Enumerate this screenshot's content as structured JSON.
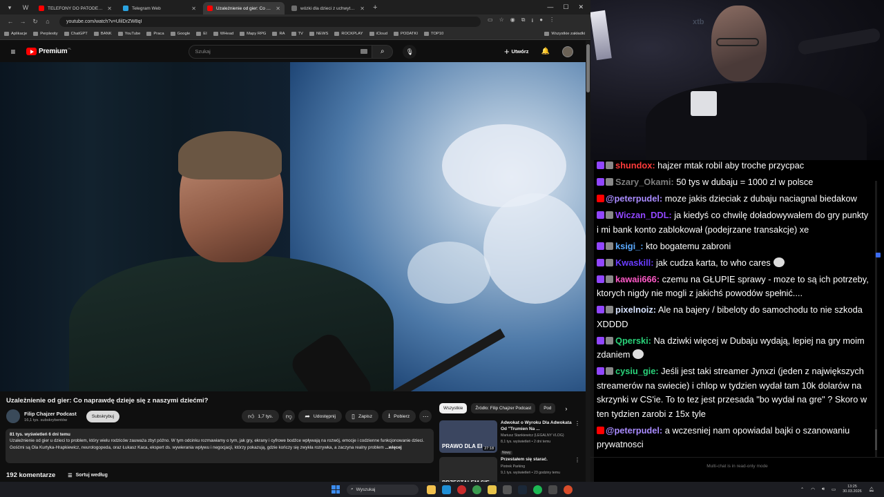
{
  "browser": {
    "tabs": [
      {
        "label": "TELEFONY DO PATODEWELOPE",
        "color": "#ff0000",
        "active": false
      },
      {
        "label": "Telegram Web",
        "color": "#2aa3e0",
        "active": false
      },
      {
        "label": "Uzależnienie od gier: Co napraw",
        "color": "#ff0000",
        "active": true
      },
      {
        "label": "wózki dla dzieci z uchwytem na",
        "color": "#6e6e6e",
        "active": false
      }
    ],
    "url": "youtube.com/watch?v=UlilDrZW8qI",
    "bookmarks": [
      "Aplikacje",
      "Perplexity",
      "ChatGPT",
      "BANK",
      "YouTube",
      "Praca",
      "Google",
      "EI",
      "WHead",
      "Mapy RPG",
      "RA",
      "TV",
      "NEWS",
      "ROCKPLAY",
      "iCloud",
      "PODATKI",
      "TOP10"
    ],
    "all_bookmarks": "Wszystkie zakładki"
  },
  "youtube": {
    "logo_text": "Premium",
    "logo_country": "PL",
    "search_placeholder": "Szukaj",
    "create_label": "Utwórz",
    "video_title": "Uzależnienie od gier: Co naprawdę dzieje się z naszymi dziećmi?",
    "channel_name": "Filip Chajzer Podcast",
    "channel_subs": "16,1 tys. subskrybentów",
    "subscribe_label": "Subskrybuj",
    "likes": "1,7 tys.",
    "share_label": "Udostępnij",
    "save_label": "Zapisz",
    "download_label": "Pobierz",
    "desc_meta": "81 tys. wyświetleń  6 dni temu",
    "desc_text": "Uzależnienie od gier u dzieci to problem, który wielu rodziców zauważa zbyt późno. W tym odcinku rozmawiamy o tym, jak gry, ekrany i cyfrowe bodźce wpływają na rozwój, emocje i codzienne funkcjonowanie dzieci. Gośćmi są Ola Kurtyka-Hrapkiewicz, neurologopeda, oraz Łukasz Kaca, ekspert ds. wywierania wpływu i negocjacji, którzy pokazują, gdzie kończy się zwykła rozrywka, a zaczyna realny problem",
    "desc_more": "...więcej",
    "comments_count": "192 komentarze",
    "sort_label": "Sortuj według",
    "chips": [
      "Wszystkie",
      "Źródło: Filip Chajzer Podcast",
      "Pod"
    ],
    "recs": [
      {
        "title": "Adwokat o Wyroku Dla Adwokata Od \"Trumien Na ...",
        "channel": "Mariusz Stankiewicz (LEGALNY VLOG)",
        "meta": "8,1 tys. wyświetleń • 2 dni temu",
        "badge": "Nowy",
        "duration": "27:18",
        "overlay": "PRAWO DLA EI",
        "thumb": "#3b4660"
      },
      {
        "title": "Przestałem się starać.",
        "channel": "Piotrek Parking",
        "meta": "9,1 tys. wyświetleń • 23 godziny temu",
        "badge": "",
        "duration": "",
        "overlay": "PRZESTAŁEM SIĘ",
        "thumb": "#2a2a2a"
      }
    ]
  },
  "chat": {
    "messages": [
      {
        "platform": "twitch",
        "user": "shundox:",
        "color": "#ff3b3b",
        "text": "hajzer mtak robil aby troche przycpac",
        "emote": false
      },
      {
        "platform": "twitch",
        "user": "Szary_Okami:",
        "color": "#7d7d7d",
        "text": "50 tys w dubaju = 1000 zl w polsce",
        "emote": false
      },
      {
        "platform": "yt",
        "user": "@peterpudel:",
        "color": "#a98bff",
        "text": "moze jakis dzieciak z dubaju naciagnal biedakow",
        "emote": false
      },
      {
        "platform": "twitch",
        "user": "Wiczan_DDL:",
        "color": "#9146ff",
        "text": "ja kiedyś co chwilę doładowywałem do gry punkty i mi bank konto zablokował (podejrzane transakcje) xe",
        "emote": false
      },
      {
        "platform": "twitch",
        "user": "ksigi_:",
        "color": "#5aa9ff",
        "text": "kto bogatemu zabroni",
        "emote": false
      },
      {
        "platform": "twitch",
        "user": "Kwaskill:",
        "color": "#6a3cff",
        "text": "jak cudza karta, to who cares",
        "emote": true
      },
      {
        "platform": "twitch",
        "user": "kawaii666:",
        "color": "#ff5ac8",
        "text": "czemu na GŁUPIE sprawy - moze to są ich potrzeby, ktorych nigdy nie mogli z jakichś powodów spełnić....",
        "emote": false
      },
      {
        "platform": "twitch",
        "user": "pixelnoiz:",
        "color": "#d7e3ff",
        "text": "Ale na bajery / bibeloty do samochodu to nie szkoda XDDDD",
        "emote": false
      },
      {
        "platform": "twitch",
        "user": "Qperski:",
        "color": "#2ad37a",
        "text": "Na dziwki więcej w Dubaju wydają, lepiej na gry moim zdaniem",
        "emote": true
      },
      {
        "platform": "twitch",
        "user": "cysiu_gie:",
        "color": "#2ad37a",
        "text": "Jeśli jest taki streamer Jynxzi (jeden z największych streamerów na swiecie) i chlop w tydzien wydał tam 10k dolarów na skrzynki w CS'ie. To to tez jest przesada \"bo wydał na gre\" ? Skoro w ten tydzien zarobi z 15x tyle",
        "emote": false
      },
      {
        "platform": "yt",
        "user": "@peterpudel:",
        "color": "#a98bff",
        "text": "a wczesniej nam opowiadal bajki o szanowaniu prywatnosci",
        "emote": false
      }
    ],
    "footer": "Multi-chat is in read-only mode"
  },
  "taskbar": {
    "search_placeholder": "Wyszukaj",
    "time": "13:25",
    "date": "30.03.2026"
  },
  "webcam": {
    "brand_text": "xtb"
  }
}
